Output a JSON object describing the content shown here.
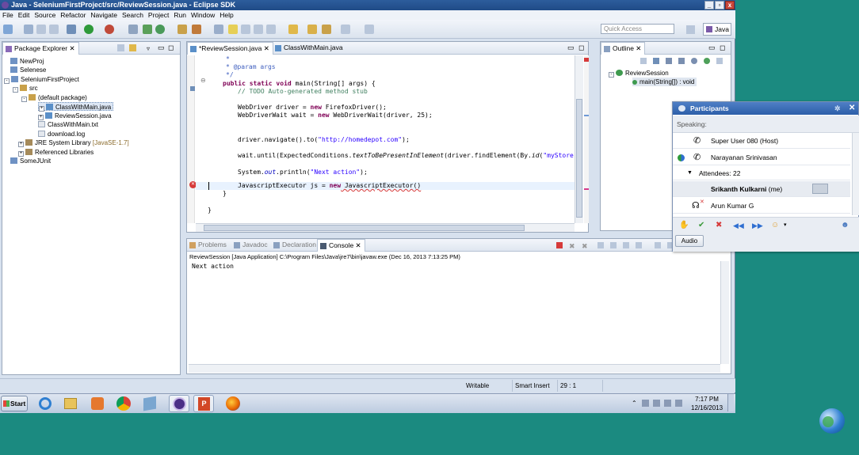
{
  "window": {
    "title": "Java - SeleniumFirstProject/src/ReviewSession.java - Eclipse SDK"
  },
  "menu": [
    "File",
    "Edit",
    "Source",
    "Refactor",
    "Navigate",
    "Search",
    "Project",
    "Run",
    "Window",
    "Help"
  ],
  "toolbar": {
    "quick_access_placeholder": "Quick Access",
    "perspective": "Java"
  },
  "package_explorer": {
    "tab": "Package Explorer",
    "items": [
      {
        "label": "NewProj",
        "level": 1,
        "icon": "project-icon"
      },
      {
        "label": "Selenese",
        "level": 1,
        "icon": "project-icon"
      },
      {
        "label": "SeleniumFirstProject",
        "level": 1,
        "icon": "project-icon"
      },
      {
        "label": "src",
        "level": 2,
        "icon": "source-folder-icon"
      },
      {
        "label": "(default package)",
        "level": 3,
        "icon": "package-icon"
      },
      {
        "label": "ClassWithMain.java",
        "level": 4,
        "icon": "java-file-icon"
      },
      {
        "label": "ReviewSession.java",
        "level": 4,
        "icon": "java-file-icon"
      },
      {
        "label": "ClassWithMain.txt",
        "level": 3,
        "icon": "text-file-icon"
      },
      {
        "label": "download.log",
        "level": 3,
        "icon": "text-file-icon"
      },
      {
        "label": "JRE System Library",
        "suffix": "[JavaSE-1.7]",
        "level": 2,
        "icon": "library-icon"
      },
      {
        "label": "Referenced Libraries",
        "level": 2,
        "icon": "library-icon"
      },
      {
        "label": "SomeJUnit",
        "level": 1,
        "icon": "project-icon"
      }
    ]
  },
  "editor": {
    "tabs": [
      "*ReviewSession.java",
      "ClassWithMain.java"
    ],
    "lines": {
      "l1": "*",
      "l2": "* @param args",
      "l3": "*/",
      "l4_kw": "public static void",
      "l4_rest": " main(String[] args) {",
      "l5": "// TODO Auto-generated method stub",
      "l6_a": "WebDriver driver = ",
      "l6_kw": "new",
      "l6_b": " FirefoxDriver();",
      "l7_a": "WebDriverWait wait = ",
      "l7_kw": "new",
      "l7_b": " WebDriverWait(driver, 25);",
      "l8_a": "driver.navigate().to(",
      "l8_str": "\"http://homedepot.com\"",
      "l8_b": ");",
      "l9_a": "wait.until(ExpectedConditions.",
      "l9_it": "textToBePresentInElement",
      "l9_b": "(driver.findElement(By.",
      "l9_it2": "id",
      "l9_c": "(",
      "l9_str": "\"myStore\"",
      "l10_a": "System.",
      "l10_fld": "out",
      "l10_b": ".println(",
      "l10_str": "\"Next action\"",
      "l10_c": ");",
      "l11_a": "JavascriptExecutor js = ",
      "l11_kw": "new",
      "l11_b": " JavascriptExecutor()",
      "l12": "}",
      "l13": "}"
    }
  },
  "outline": {
    "tab": "Outline",
    "items": [
      "ReviewSession",
      "main(String[]) : void"
    ]
  },
  "bottom": {
    "tabs": [
      "Problems",
      "Javadoc",
      "Declaration",
      "Console"
    ],
    "console_header": "ReviewSession [Java Application] C:\\Program Files\\Java\\jre7\\bin\\javaw.exe (Dec 16, 2013 7:13:25 PM)",
    "console_output": "Next action"
  },
  "statusbar": {
    "writable": "Writable",
    "insert_mode": "Smart Insert",
    "position": "29 : 1"
  },
  "participants": {
    "title": "Participants",
    "speaking_label": "Speaking:",
    "people": [
      {
        "name": "Super User 080 (Host)",
        "icon": "phone-icon"
      },
      {
        "name": "Narayanan Srinivasan",
        "icon": "phone-icon"
      }
    ],
    "attendees_label": "Attendees: 22",
    "attendees": [
      {
        "name": "Srikanth Kulkarni",
        "suffix": "(me)"
      },
      {
        "name": "Arun Kumar G"
      }
    ],
    "audio_button": "Audio"
  },
  "taskbar": {
    "start": "Start",
    "clock_time": "7:17 PM",
    "clock_date": "12/16/2013"
  }
}
